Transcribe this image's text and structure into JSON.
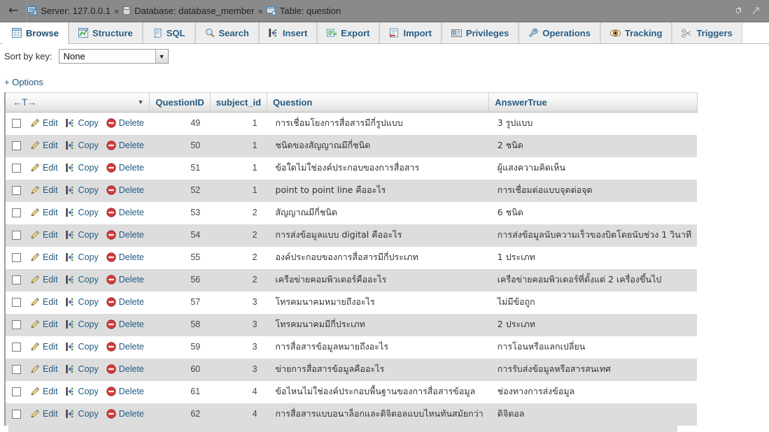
{
  "breadcrumb": {
    "back_label": "←",
    "server_label": "Server: 127.0.0.1",
    "sep1": "»",
    "database_label": "Database: database_member",
    "sep2": "»",
    "table_label": "Table: question"
  },
  "window_controls": {
    "gear_icon": "gear-icon",
    "clipped_icon": "arrow-icon"
  },
  "tabs": [
    {
      "label": "Browse",
      "icon": "browse-icon",
      "active": true
    },
    {
      "label": "Structure",
      "icon": "structure-icon",
      "active": false
    },
    {
      "label": "SQL",
      "icon": "sql-icon",
      "active": false
    },
    {
      "label": "Search",
      "icon": "search-icon",
      "active": false
    },
    {
      "label": "Insert",
      "icon": "insert-icon",
      "active": false
    },
    {
      "label": "Export",
      "icon": "export-icon",
      "active": false
    },
    {
      "label": "Import",
      "icon": "import-icon",
      "active": false
    },
    {
      "label": "Privileges",
      "icon": "privileges-icon",
      "active": false
    },
    {
      "label": "Operations",
      "icon": "operations-icon",
      "active": false
    },
    {
      "label": "Tracking",
      "icon": "tracking-icon",
      "active": false
    },
    {
      "label": "Triggers",
      "icon": "triggers-icon",
      "active": false
    }
  ],
  "sort": {
    "label": "Sort by key:",
    "value": "None",
    "options": [
      "None"
    ]
  },
  "options_link": "+ Options",
  "table": {
    "headers": {
      "actions": "",
      "questionid": "QuestionID",
      "subject_id": "subject_id",
      "question": "Question",
      "answertrue": "AnswerTrue"
    },
    "row_actions": {
      "edit": "Edit",
      "copy": "Copy",
      "delete": "Delete"
    },
    "rows": [
      {
        "QuestionID": "49",
        "subject_id": "1",
        "Question": "การเชื่อมโยงการสื่อสารมีกี่รูปแบบ",
        "AnswerTrue": "3 รูปแบบ"
      },
      {
        "QuestionID": "50",
        "subject_id": "1",
        "Question": "ชนิดของสัญญาณมีกี่ชนิด",
        "AnswerTrue": "2 ชนิด"
      },
      {
        "QuestionID": "51",
        "subject_id": "1",
        "Question": "ข้อใดไม่ใช่องค์ประกอบของการสื่อสาร",
        "AnswerTrue": "ผู้แสงความคิดเห็น"
      },
      {
        "QuestionID": "52",
        "subject_id": "1",
        "Question": "point to point line คืออะไร",
        "AnswerTrue": "การเชื่อมต่อแบบจุดต่อจุด"
      },
      {
        "QuestionID": "53",
        "subject_id": "2",
        "Question": "สัญญาณมีกี่ชนิด",
        "AnswerTrue": "6 ชนิด"
      },
      {
        "QuestionID": "54",
        "subject_id": "2",
        "Question": "การส่งข้อมูลแบบ digital คืออะไร",
        "AnswerTrue": "การส่งข้อมูลนับความเร็วของบิตโดยนับช่วง 1 วินาที"
      },
      {
        "QuestionID": "55",
        "subject_id": "2",
        "Question": "องค์ประกอบของการสื่อสารมีกี่ประเภท",
        "AnswerTrue": "1 ประเภท"
      },
      {
        "QuestionID": "56",
        "subject_id": "2",
        "Question": "เครือข่ายคอมพิวเตอร์คืออะไร",
        "AnswerTrue": "เครือข่ายคอมพิวเตอร์ที่ตั้งแต่ 2 เครื่องขึ้นไป"
      },
      {
        "QuestionID": "57",
        "subject_id": "3",
        "Question": "โทรคมนาคมหมายถึงอะไร",
        "AnswerTrue": "ไม่มีข้อถูก"
      },
      {
        "QuestionID": "58",
        "subject_id": "3",
        "Question": "โทรคมนาคมมีกี่ประเภท",
        "AnswerTrue": "2 ประเภท"
      },
      {
        "QuestionID": "59",
        "subject_id": "3",
        "Question": "การสื่อสารข้อมูลหมายถึงอะไร",
        "AnswerTrue": "การโอนหรือแลกเปลี่ยน"
      },
      {
        "QuestionID": "60",
        "subject_id": "3",
        "Question": "ข่ายการสื่อสารข้อมูลคืออะไร",
        "AnswerTrue": "การรับส่งข้อมูลหรือสารสนเทศ"
      },
      {
        "QuestionID": "61",
        "subject_id": "4",
        "Question": "ข้อไหนไม่ใช่องค์ประกอบพื้นฐานของการสื่อสารข้อมูล",
        "AnswerTrue": "ช่องทางการส่งข้อมูล"
      },
      {
        "QuestionID": "62",
        "subject_id": "4",
        "Question": "การสื่อสารแบบอนาล็อกและดิจิตอลแบบไหนทันสมัยกว่า",
        "AnswerTrue": "ดิจิตอล"
      }
    ]
  },
  "colors": {
    "topbar": "#8a8a8a",
    "link": "#235a81",
    "header_text": "#235a81",
    "row_even": "#dddddd",
    "row_odd": "#ffffff",
    "tab_inactive": "#ededed"
  }
}
